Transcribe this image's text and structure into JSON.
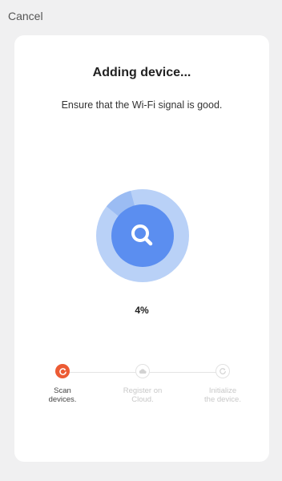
{
  "header": {
    "cancel_label": "Cancel"
  },
  "card": {
    "title": "Adding device...",
    "subtitle": "Ensure that the Wi-Fi signal is good.",
    "progress": {
      "value_fraction": 0.04,
      "label": "4%"
    },
    "steps": [
      {
        "label": "Scan\ndevices.",
        "state": "active",
        "icon": "refresh-icon"
      },
      {
        "label": "Register on\nCloud.",
        "state": "inactive",
        "icon": "cloud-icon"
      },
      {
        "label": "Initialize\nthe device.",
        "state": "inactive",
        "icon": "refresh-icon"
      }
    ]
  },
  "colors": {
    "accent_blue": "#5b8ef0",
    "ring_light_blue": "#b9d1f7",
    "ring_mid_blue": "#9bbcf3",
    "step_active": "#ec5b34",
    "background": "#f0f0f1"
  }
}
